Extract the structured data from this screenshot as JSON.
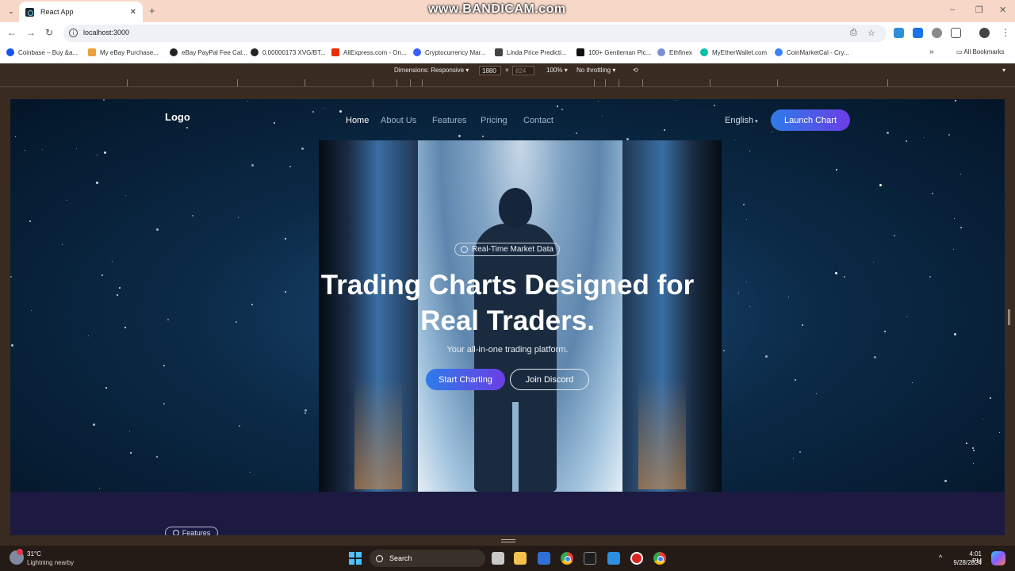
{
  "browser": {
    "tab_title": "React App",
    "url": "localhost:3000",
    "watermark": "www.BANDICAM.com",
    "bookmarks": [
      {
        "label": "Coinbase – Buy &a...",
        "color": "#1652f0"
      },
      {
        "label": "My eBay Purchase...",
        "color": "#e8a33d"
      },
      {
        "label": "eBay PayPal Fee Cal...",
        "color": "#222222"
      },
      {
        "label": "0.00000173 XVG/BT...",
        "color": "#222222"
      },
      {
        "label": "AliExpress.com - On...",
        "color": "#e62e04"
      },
      {
        "label": "Cryptocurrency Mar...",
        "color": "#3861fb"
      },
      {
        "label": "Linda Price Predicti...",
        "color": "#444444"
      },
      {
        "label": "100+ Gentleman Pic...",
        "color": "#111111"
      },
      {
        "label": "Ethfinex",
        "color": "#7b8fd6"
      },
      {
        "label": "MyEtherWallet.com",
        "color": "#05c0a5"
      },
      {
        "label": "CoinMarketCal - Cry...",
        "color": "#3b82f6"
      }
    ],
    "all_bookmarks": "All Bookmarks"
  },
  "devtools": {
    "dimensions": "Dimensions: Responsive",
    "width": "1880",
    "height": "824",
    "zoom": "100%",
    "throttling": "No throttling"
  },
  "page": {
    "logo": "Logo",
    "nav": [
      "Home",
      "About Us",
      "Features",
      "Pricing",
      "Contact"
    ],
    "language": "English",
    "launch_button": "Launch Chart",
    "badge": "Real-Time Market Data",
    "headline_line1": "Trading Charts Designed for",
    "headline_line2": "Real Traders.",
    "subheadline": "Your all-in-one trading platform.",
    "start_button": "Start Charting",
    "discord_button": "Join Discord",
    "features_pill": "Features",
    "accent_gradient": [
      "#2f7be8",
      "#6a3ee6"
    ]
  },
  "taskbar": {
    "temperature": "31°C",
    "weather": "Lightning nearby",
    "search": "Search",
    "time": "4:01 PM",
    "date": "9/28/2024"
  }
}
